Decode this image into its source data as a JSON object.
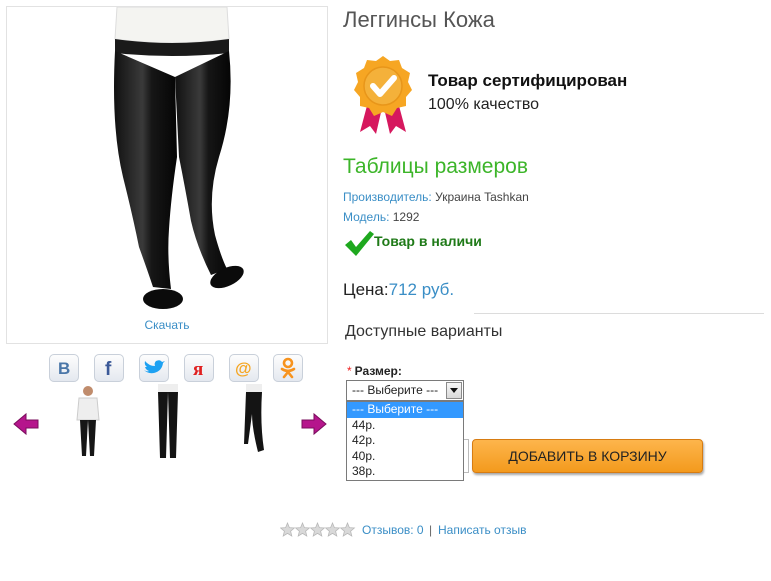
{
  "product": {
    "title": "Леггинсы Кожа",
    "download_label": "Скачать"
  },
  "social": {
    "buttons": [
      {
        "name": "vkontakte",
        "glyph": "В",
        "color": "#4a76a8"
      },
      {
        "name": "facebook",
        "glyph": "f",
        "color": "#3b5998"
      },
      {
        "name": "twitter",
        "color": "#1da1f2"
      },
      {
        "name": "yaru",
        "glyph": "я",
        "color": "#e02020"
      },
      {
        "name": "mailru",
        "glyph": "@",
        "color": "#f5a623"
      },
      {
        "name": "odnoklassniki",
        "color": "#f7931e"
      }
    ]
  },
  "certificate": {
    "title": "Товар сертифицирован",
    "subtitle": "100% качество",
    "badge_color": "#f6a623",
    "ribbon_color": "#d6185e"
  },
  "size_table_link": "Таблицы размеров",
  "specs": {
    "manufacturer_label": "Производитель:",
    "manufacturer_value": "Украина Tashkan",
    "model_label": "Модель:",
    "model_value": "1292"
  },
  "stock": {
    "text": "Товар в наличи",
    "color": "#1f7a18"
  },
  "price": {
    "label": "Цена:",
    "value": "712 руб."
  },
  "variants": {
    "title": "Доступные варианты",
    "size_label": "Размер:",
    "required_mark": "*",
    "selected": "--- Выберите ---",
    "options": [
      "--- Выберите ---",
      "44р.",
      "42р.",
      "40р.",
      "38р."
    ]
  },
  "cart": {
    "add_label": "ДОБАВИТЬ В КОРЗИНУ",
    "button_color": "#f7a531"
  },
  "reviews": {
    "rating": 0,
    "max": 5,
    "reviews_link": "Отзывов: 0",
    "separator": "|",
    "write_link": "Написать отзыв"
  },
  "accent_colors": {
    "link": "#3a8ec6",
    "green": "#3cb529"
  }
}
